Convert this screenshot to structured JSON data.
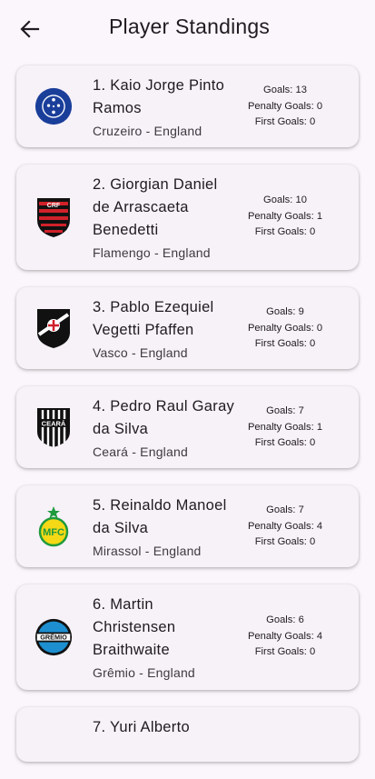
{
  "header": {
    "title": "Player Standings"
  },
  "labels": {
    "goals": "Goals:",
    "penalty": "Penalty Goals:",
    "first": "First Goals:"
  },
  "players": [
    {
      "name": "1. Kaio Jorge Pinto Ramos",
      "club": "Cruzeiro - England",
      "goals": 13,
      "penalty": 0,
      "first": 0,
      "icon": "cruzeiro-logo"
    },
    {
      "name": "2. Giorgian Daniel de Arrascaeta Benedetti",
      "club": "Flamengo - England",
      "goals": 10,
      "penalty": 1,
      "first": 0,
      "icon": "flamengo-logo"
    },
    {
      "name": "3. Pablo Ezequiel Vegetti Pfaffen",
      "club": "Vasco - England",
      "goals": 9,
      "penalty": 0,
      "first": 0,
      "icon": "vasco-logo"
    },
    {
      "name": "4. Pedro Raul Garay da Silva",
      "club": "Ceará - England",
      "goals": 7,
      "penalty": 1,
      "first": 0,
      "icon": "ceara-logo"
    },
    {
      "name": "5. Reinaldo Manoel da Silva",
      "club": "Mirassol - England",
      "goals": 7,
      "penalty": 4,
      "first": 0,
      "icon": "mirassol-logo"
    },
    {
      "name": "6. Martin Christensen Braithwaite",
      "club": "Grêmio - England",
      "goals": 6,
      "penalty": 4,
      "first": 0,
      "icon": "gremio-logo"
    },
    {
      "name": "7. Yuri Alberto",
      "club": "",
      "goals": null,
      "penalty": null,
      "first": null,
      "icon": ""
    }
  ]
}
